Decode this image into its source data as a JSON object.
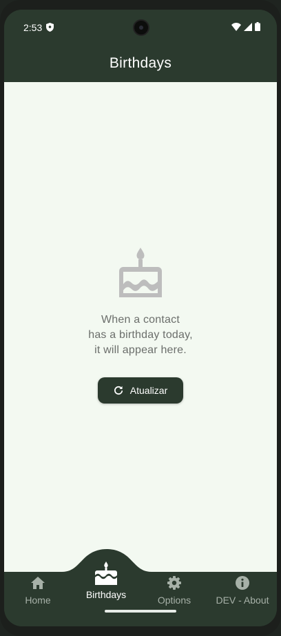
{
  "status_bar": {
    "time": "2:53"
  },
  "app_bar": {
    "title": "Birthdays"
  },
  "empty_state": {
    "icon": "cake-icon",
    "line1": "When a contact",
    "line2": "has a birthday today,",
    "line3": "it will appear here."
  },
  "refresh_button": {
    "label": "Atualizar",
    "icon": "refresh-icon"
  },
  "bottom_nav": {
    "items": [
      {
        "label": "Home",
        "icon": "home-icon",
        "active": false
      },
      {
        "label": "Birthdays",
        "icon": "cake-icon",
        "active": true
      },
      {
        "label": "Options",
        "icon": "gear-icon",
        "active": false
      },
      {
        "label": "DEV - About",
        "icon": "info-icon",
        "active": false
      }
    ]
  },
  "colors": {
    "primary": "#2b3a2e",
    "background": "#f3f9f1",
    "muted_text": "#6b6e6b",
    "inactive_nav": "#a7b1a8",
    "icon_gray": "#bdbdbd"
  }
}
